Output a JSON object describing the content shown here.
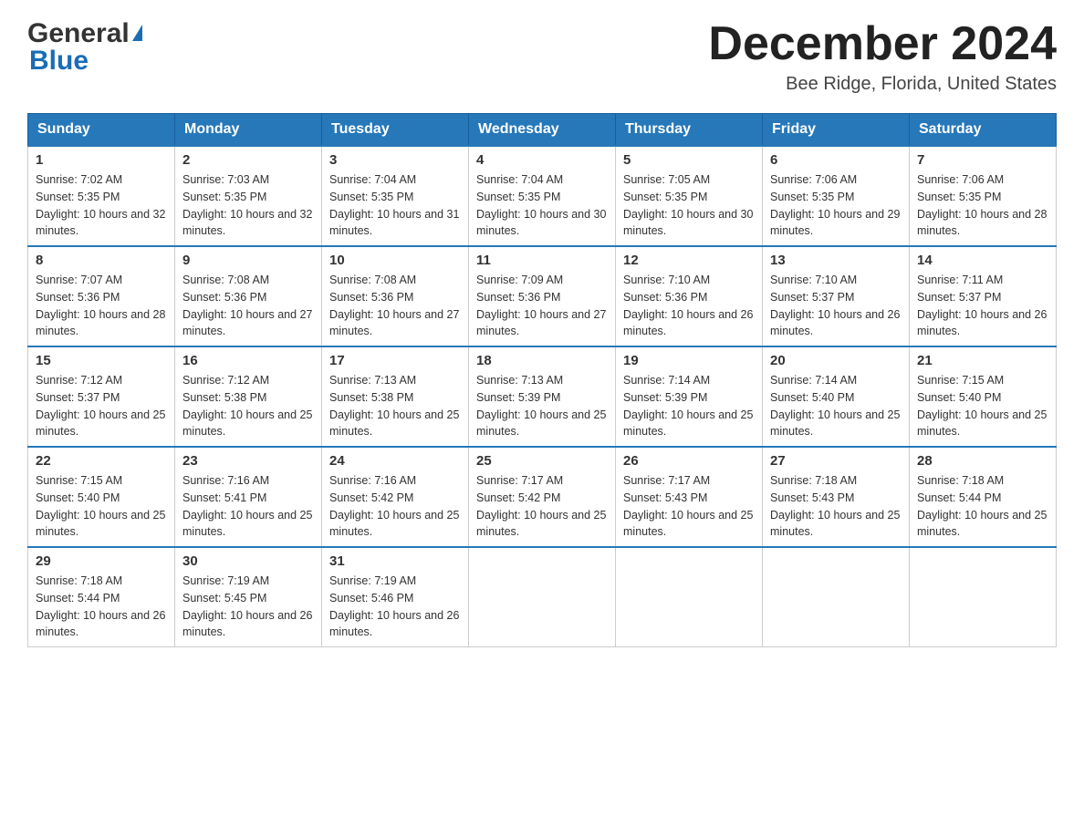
{
  "header": {
    "logo_general": "General",
    "logo_blue": "Blue",
    "month_title": "December 2024",
    "location": "Bee Ridge, Florida, United States"
  },
  "days_of_week": [
    "Sunday",
    "Monday",
    "Tuesday",
    "Wednesday",
    "Thursday",
    "Friday",
    "Saturday"
  ],
  "weeks": [
    [
      {
        "day": "1",
        "sunrise": "7:02 AM",
        "sunset": "5:35 PM",
        "daylight": "10 hours and 32 minutes."
      },
      {
        "day": "2",
        "sunrise": "7:03 AM",
        "sunset": "5:35 PM",
        "daylight": "10 hours and 32 minutes."
      },
      {
        "day": "3",
        "sunrise": "7:04 AM",
        "sunset": "5:35 PM",
        "daylight": "10 hours and 31 minutes."
      },
      {
        "day": "4",
        "sunrise": "7:04 AM",
        "sunset": "5:35 PM",
        "daylight": "10 hours and 30 minutes."
      },
      {
        "day": "5",
        "sunrise": "7:05 AM",
        "sunset": "5:35 PM",
        "daylight": "10 hours and 30 minutes."
      },
      {
        "day": "6",
        "sunrise": "7:06 AM",
        "sunset": "5:35 PM",
        "daylight": "10 hours and 29 minutes."
      },
      {
        "day": "7",
        "sunrise": "7:06 AM",
        "sunset": "5:35 PM",
        "daylight": "10 hours and 28 minutes."
      }
    ],
    [
      {
        "day": "8",
        "sunrise": "7:07 AM",
        "sunset": "5:36 PM",
        "daylight": "10 hours and 28 minutes."
      },
      {
        "day": "9",
        "sunrise": "7:08 AM",
        "sunset": "5:36 PM",
        "daylight": "10 hours and 27 minutes."
      },
      {
        "day": "10",
        "sunrise": "7:08 AM",
        "sunset": "5:36 PM",
        "daylight": "10 hours and 27 minutes."
      },
      {
        "day": "11",
        "sunrise": "7:09 AM",
        "sunset": "5:36 PM",
        "daylight": "10 hours and 27 minutes."
      },
      {
        "day": "12",
        "sunrise": "7:10 AM",
        "sunset": "5:36 PM",
        "daylight": "10 hours and 26 minutes."
      },
      {
        "day": "13",
        "sunrise": "7:10 AM",
        "sunset": "5:37 PM",
        "daylight": "10 hours and 26 minutes."
      },
      {
        "day": "14",
        "sunrise": "7:11 AM",
        "sunset": "5:37 PM",
        "daylight": "10 hours and 26 minutes."
      }
    ],
    [
      {
        "day": "15",
        "sunrise": "7:12 AM",
        "sunset": "5:37 PM",
        "daylight": "10 hours and 25 minutes."
      },
      {
        "day": "16",
        "sunrise": "7:12 AM",
        "sunset": "5:38 PM",
        "daylight": "10 hours and 25 minutes."
      },
      {
        "day": "17",
        "sunrise": "7:13 AM",
        "sunset": "5:38 PM",
        "daylight": "10 hours and 25 minutes."
      },
      {
        "day": "18",
        "sunrise": "7:13 AM",
        "sunset": "5:39 PM",
        "daylight": "10 hours and 25 minutes."
      },
      {
        "day": "19",
        "sunrise": "7:14 AM",
        "sunset": "5:39 PM",
        "daylight": "10 hours and 25 minutes."
      },
      {
        "day": "20",
        "sunrise": "7:14 AM",
        "sunset": "5:40 PM",
        "daylight": "10 hours and 25 minutes."
      },
      {
        "day": "21",
        "sunrise": "7:15 AM",
        "sunset": "5:40 PM",
        "daylight": "10 hours and 25 minutes."
      }
    ],
    [
      {
        "day": "22",
        "sunrise": "7:15 AM",
        "sunset": "5:40 PM",
        "daylight": "10 hours and 25 minutes."
      },
      {
        "day": "23",
        "sunrise": "7:16 AM",
        "sunset": "5:41 PM",
        "daylight": "10 hours and 25 minutes."
      },
      {
        "day": "24",
        "sunrise": "7:16 AM",
        "sunset": "5:42 PM",
        "daylight": "10 hours and 25 minutes."
      },
      {
        "day": "25",
        "sunrise": "7:17 AM",
        "sunset": "5:42 PM",
        "daylight": "10 hours and 25 minutes."
      },
      {
        "day": "26",
        "sunrise": "7:17 AM",
        "sunset": "5:43 PM",
        "daylight": "10 hours and 25 minutes."
      },
      {
        "day": "27",
        "sunrise": "7:18 AM",
        "sunset": "5:43 PM",
        "daylight": "10 hours and 25 minutes."
      },
      {
        "day": "28",
        "sunrise": "7:18 AM",
        "sunset": "5:44 PM",
        "daylight": "10 hours and 25 minutes."
      }
    ],
    [
      {
        "day": "29",
        "sunrise": "7:18 AM",
        "sunset": "5:44 PM",
        "daylight": "10 hours and 26 minutes."
      },
      {
        "day": "30",
        "sunrise": "7:19 AM",
        "sunset": "5:45 PM",
        "daylight": "10 hours and 26 minutes."
      },
      {
        "day": "31",
        "sunrise": "7:19 AM",
        "sunset": "5:46 PM",
        "daylight": "10 hours and 26 minutes."
      },
      {
        "day": "",
        "sunrise": "",
        "sunset": "",
        "daylight": ""
      },
      {
        "day": "",
        "sunrise": "",
        "sunset": "",
        "daylight": ""
      },
      {
        "day": "",
        "sunrise": "",
        "sunset": "",
        "daylight": ""
      },
      {
        "day": "",
        "sunrise": "",
        "sunset": "",
        "daylight": ""
      }
    ]
  ]
}
